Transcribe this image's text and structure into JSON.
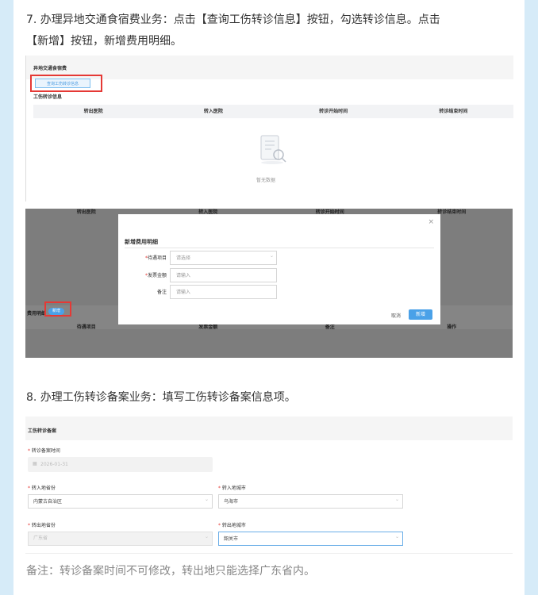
{
  "step7": {
    "text_line1": "7. 办理异地交通食宿费业务：点击【查询工伤转诊信息】按钮，勾选转诊信息。点击",
    "text_line2": "【新增】按钮，新增费用明细。"
  },
  "shot1": {
    "section_title": "异地交通食宿费",
    "query_button": "查询工伤转诊信息",
    "sub_title": "工伤转诊信息",
    "columns": [
      "转出医院",
      "转入医院",
      "转诊开始时间",
      "转诊结束时间"
    ],
    "empty_text": "暂无数据"
  },
  "shot2": {
    "bg_columns": [
      "转出医院",
      "转入医院",
      "转诊开始时间",
      "转诊结束时间"
    ],
    "modal_title": "新增费用明细",
    "close_label": "×",
    "fields": [
      {
        "label": "待遇项目",
        "placeholder": "请选择"
      },
      {
        "label": "发票金额",
        "placeholder": "请输入"
      },
      {
        "label": "备注",
        "placeholder": "请输入"
      }
    ],
    "required_mark": "*",
    "cancel_label": "取消",
    "confirm_label": "新增",
    "bottom_section_label": "费用明细",
    "bottom_add_label": "新增",
    "bottom_columns": [
      "待遇项目",
      "发票金额",
      "备注",
      "操作"
    ]
  },
  "step8": {
    "text": "8. 办理工伤转诊备案业务：填写工伤转诊备案信息项。"
  },
  "shot3": {
    "title": "工伤转诊备案",
    "date_label": "转诊备案时间",
    "date_value": "2026-01-31",
    "in_province_label": "转入地省份",
    "in_province_value": "内蒙古自治区",
    "in_city_label": "转入地城市",
    "in_city_value": "乌海市",
    "out_province_label": "转出地省份",
    "out_province_value": "广东省",
    "out_city_label": "转出地城市",
    "out_city_value": "韶关市",
    "required_mark": "*"
  },
  "note": {
    "text": "备注：转诊备案时间不可修改，转出地只能选择广东省内。"
  },
  "icons": {
    "close": "close-icon",
    "calendar": "calendar-icon",
    "dropdown": "chevron-down-icon",
    "empty": "empty-document-icon"
  }
}
